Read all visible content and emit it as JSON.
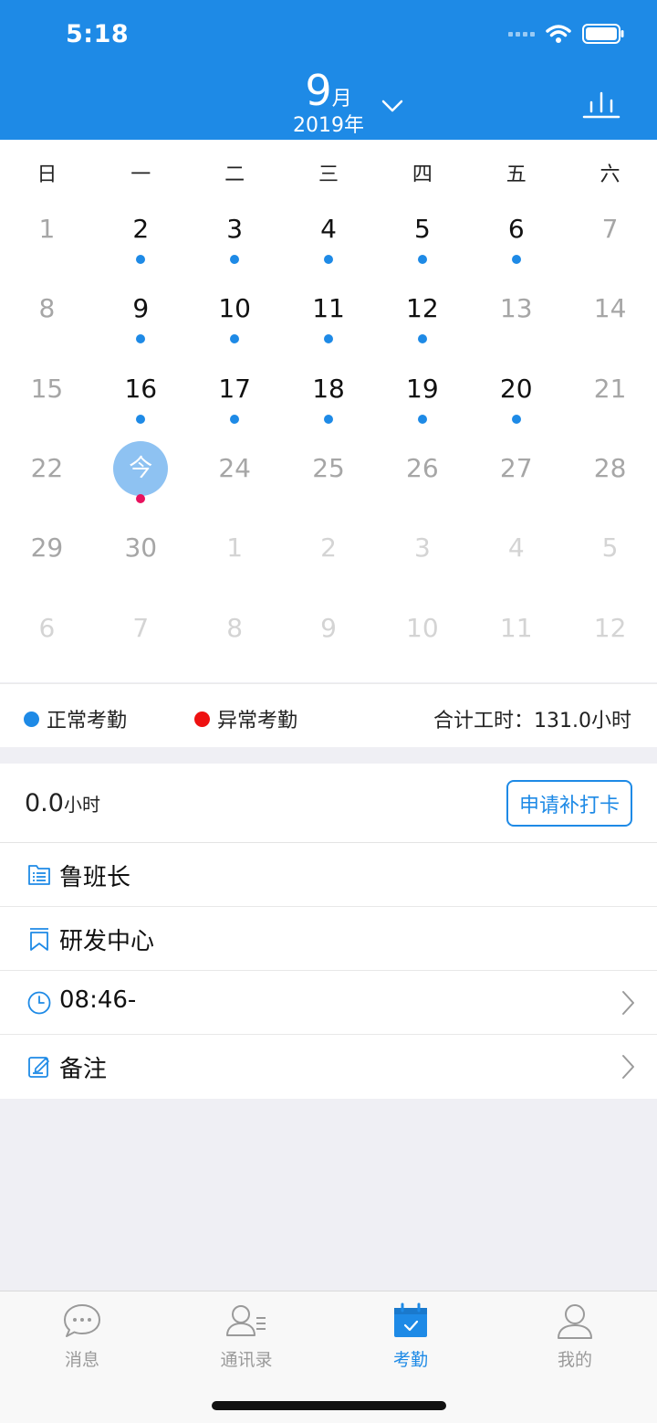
{
  "status": {
    "time": "5:18"
  },
  "header": {
    "month_num": "9",
    "month_unit": "月",
    "year": "2019年"
  },
  "colors": {
    "accent": "#1e8ae6",
    "normal_dot": "#1e8ae6",
    "abnormal_dot": "#e8125e",
    "legend_abnormal": "#ee1111",
    "today_circle": "#8ec2f2"
  },
  "calendar": {
    "weekdays": [
      "日",
      "一",
      "二",
      "三",
      "四",
      "五",
      "六"
    ],
    "today_label": "今",
    "days": [
      {
        "t": "1",
        "s": "wk",
        "d": ""
      },
      {
        "t": "2",
        "s": "cur",
        "d": "normal"
      },
      {
        "t": "3",
        "s": "cur",
        "d": "normal"
      },
      {
        "t": "4",
        "s": "cur",
        "d": "normal"
      },
      {
        "t": "5",
        "s": "cur",
        "d": "normal"
      },
      {
        "t": "6",
        "s": "cur",
        "d": "normal"
      },
      {
        "t": "7",
        "s": "wk",
        "d": ""
      },
      {
        "t": "8",
        "s": "wk",
        "d": ""
      },
      {
        "t": "9",
        "s": "cur",
        "d": "normal"
      },
      {
        "t": "10",
        "s": "cur",
        "d": "normal"
      },
      {
        "t": "11",
        "s": "cur",
        "d": "normal"
      },
      {
        "t": "12",
        "s": "cur",
        "d": "normal"
      },
      {
        "t": "13",
        "s": "wk",
        "d": ""
      },
      {
        "t": "14",
        "s": "wk",
        "d": ""
      },
      {
        "t": "15",
        "s": "wk",
        "d": ""
      },
      {
        "t": "16",
        "s": "cur",
        "d": "normal"
      },
      {
        "t": "17",
        "s": "cur",
        "d": "normal"
      },
      {
        "t": "18",
        "s": "cur",
        "d": "normal"
      },
      {
        "t": "19",
        "s": "cur",
        "d": "normal"
      },
      {
        "t": "20",
        "s": "cur",
        "d": "normal"
      },
      {
        "t": "21",
        "s": "wk",
        "d": ""
      },
      {
        "t": "22",
        "s": "wk",
        "d": ""
      },
      {
        "t": "今",
        "s": "today",
        "d": "abnormal"
      },
      {
        "t": "24",
        "s": "wk",
        "d": ""
      },
      {
        "t": "25",
        "s": "wk",
        "d": ""
      },
      {
        "t": "26",
        "s": "wk",
        "d": ""
      },
      {
        "t": "27",
        "s": "wk",
        "d": ""
      },
      {
        "t": "28",
        "s": "wk",
        "d": ""
      },
      {
        "t": "29",
        "s": "wk",
        "d": ""
      },
      {
        "t": "30",
        "s": "wk",
        "d": ""
      },
      {
        "t": "1",
        "s": "other",
        "d": ""
      },
      {
        "t": "2",
        "s": "other",
        "d": ""
      },
      {
        "t": "3",
        "s": "other",
        "d": ""
      },
      {
        "t": "4",
        "s": "other",
        "d": ""
      },
      {
        "t": "5",
        "s": "other",
        "d": ""
      },
      {
        "t": "6",
        "s": "other",
        "d": ""
      },
      {
        "t": "7",
        "s": "other",
        "d": ""
      },
      {
        "t": "8",
        "s": "other",
        "d": ""
      },
      {
        "t": "9",
        "s": "other",
        "d": ""
      },
      {
        "t": "10",
        "s": "other",
        "d": ""
      },
      {
        "t": "11",
        "s": "other",
        "d": ""
      },
      {
        "t": "12",
        "s": "other",
        "d": ""
      }
    ]
  },
  "legend": {
    "normal": "正常考勤",
    "abnormal": "异常考勤",
    "total": "合计工时：131.0小时"
  },
  "detail": {
    "hours_value": "0.0",
    "hours_unit": "小时",
    "apply_button": "申请补打卡",
    "rows": [
      {
        "icon": "list-folder-icon",
        "text": "鲁班长"
      },
      {
        "icon": "bookmark-icon",
        "text": "研发中心"
      },
      {
        "icon": "clock-icon",
        "text": "08:46-"
      },
      {
        "icon": "note-edit-icon",
        "text": "备注"
      }
    ]
  },
  "tabs": [
    {
      "label": "消息",
      "icon": "chat-bubble-icon",
      "active": false
    },
    {
      "label": "通讯录",
      "icon": "contacts-icon",
      "active": false
    },
    {
      "label": "考勤",
      "icon": "calendar-check-icon",
      "active": true
    },
    {
      "label": "我的",
      "icon": "person-icon",
      "active": false
    }
  ]
}
